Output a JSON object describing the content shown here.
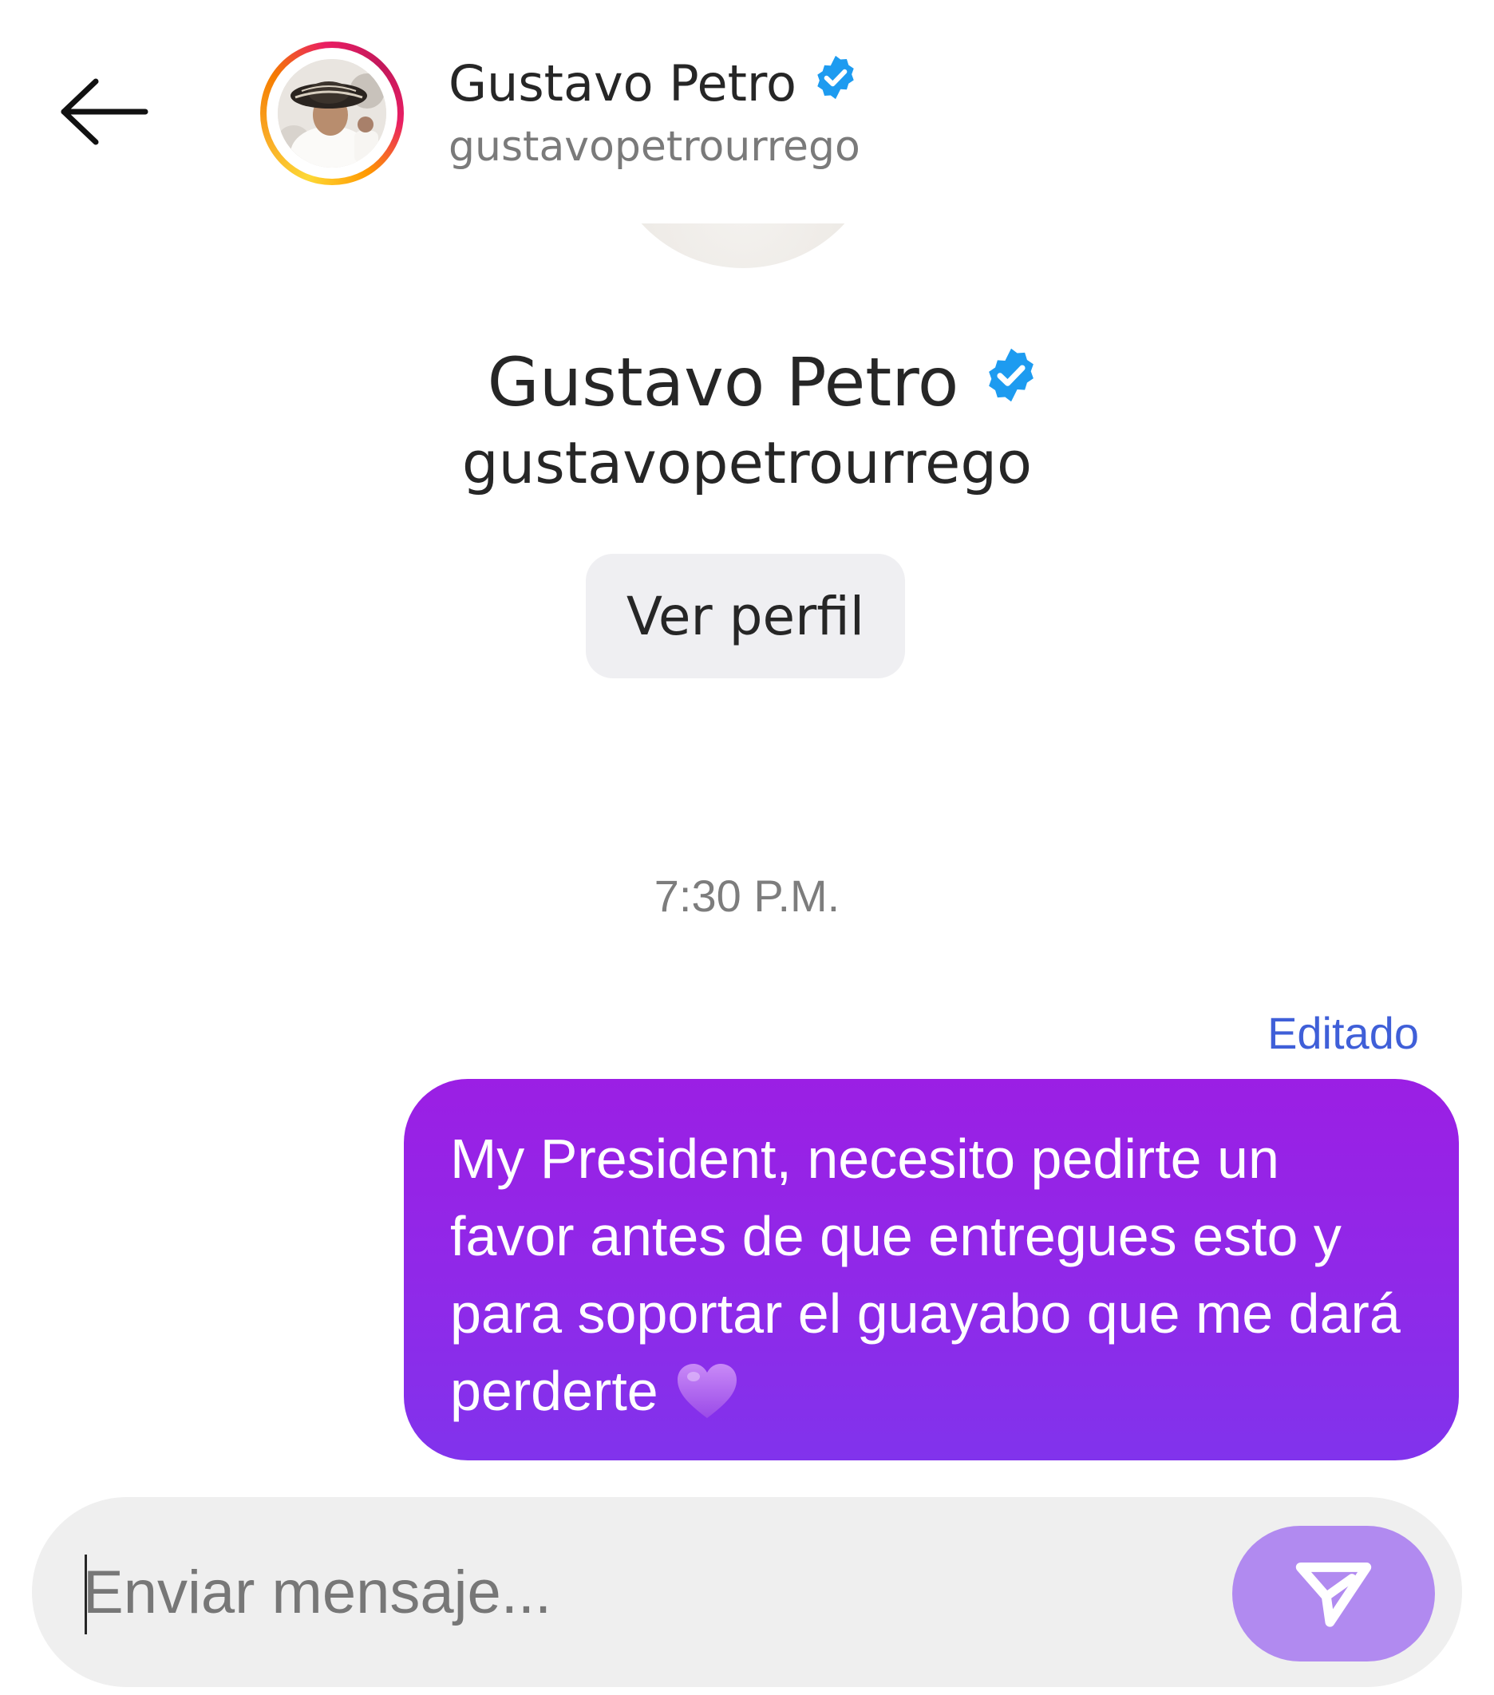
{
  "header": {
    "back_label": "back",
    "name": "Gustavo Petro",
    "handle": "gustavopetrourrego"
  },
  "profile": {
    "name": "Gustavo Petro",
    "handle": "gustavopetrourrego",
    "view_profile_label": "Ver perfil"
  },
  "conversation": {
    "timestamp": "7:30 P.M.",
    "edited_label": "Editado",
    "message_text": "My President, necesito pedirte un favor antes de que entregues esto y para soportar el guayabo que me dará perderte",
    "message_emoji": "purple-heart"
  },
  "composer": {
    "placeholder": "Enviar mensaje...",
    "value": ""
  },
  "icons": {
    "back": "arrow-left-icon",
    "verified": "verified-badge-icon",
    "send": "paper-plane-icon",
    "heart": "purple-heart-icon"
  },
  "colors": {
    "verified_blue": "#1d9bf0",
    "bubble_purple": "#9420e6",
    "edited_blue": "#3f5fd8",
    "send_button": "#b18af0"
  }
}
